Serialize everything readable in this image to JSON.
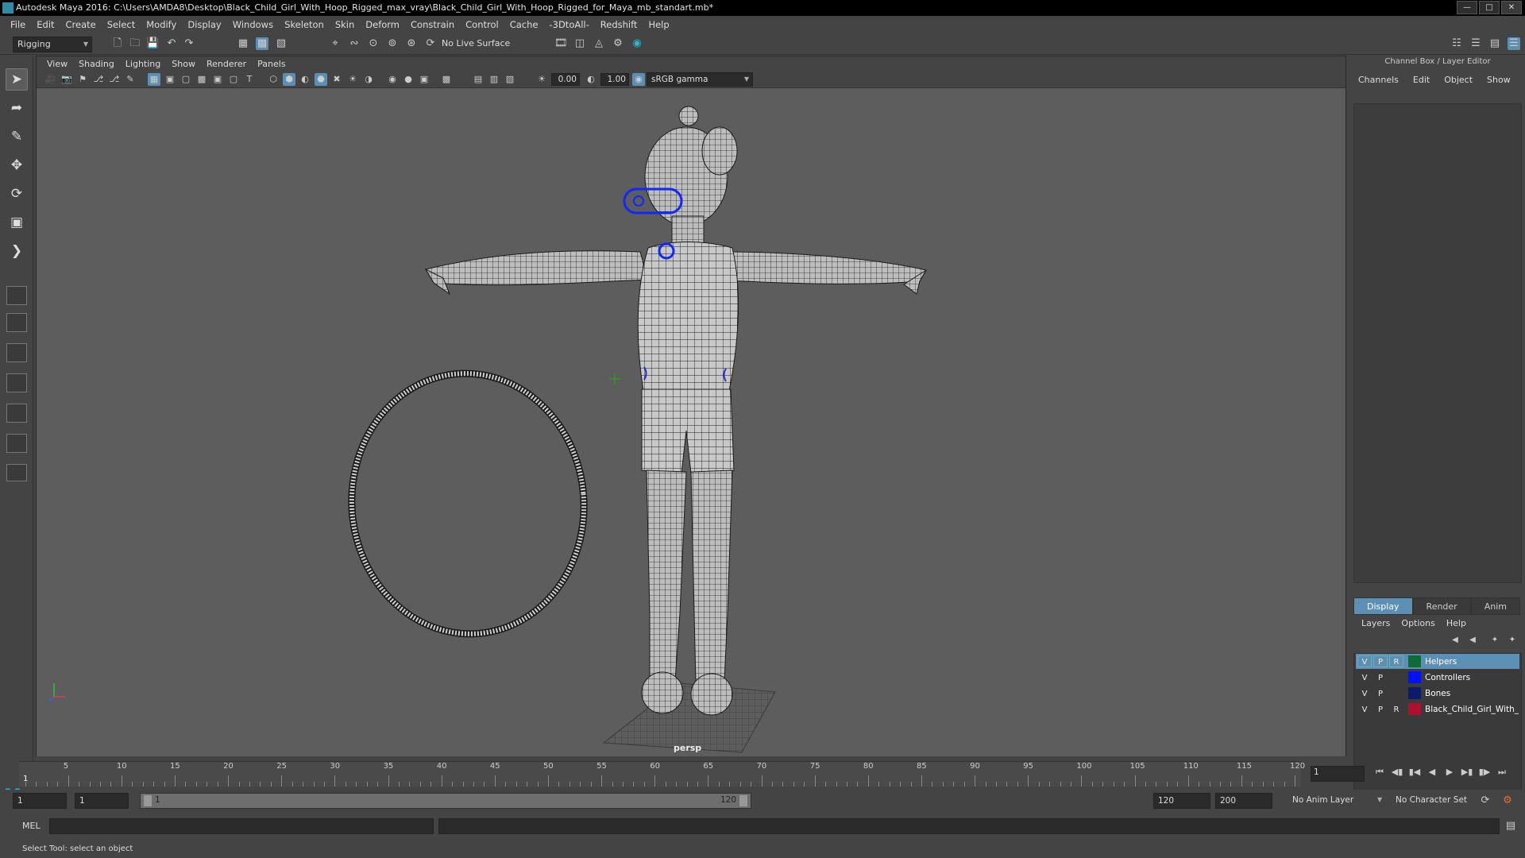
{
  "window": {
    "title": "Autodesk Maya 2016: C:\\Users\\AMDA8\\Desktop\\Black_Child_Girl_With_Hoop_Rigged_max_vray\\Black_Child_Girl_With_Hoop_Rigged_for_Maya_mb_standart.mb*"
  },
  "menubar": [
    "File",
    "Edit",
    "Create",
    "Select",
    "Modify",
    "Display",
    "Windows",
    "Skeleton",
    "Skin",
    "Deform",
    "Constrain",
    "Control",
    "Cache",
    "-3DtoAll-",
    "Redshift",
    "Help"
  ],
  "statusline": {
    "menuset": "Rigging",
    "live_surface": "No Live Surface"
  },
  "panel": {
    "menus": [
      "View",
      "Shading",
      "Lighting",
      "Show",
      "Renderer",
      "Panels"
    ],
    "exposure": "0.00",
    "gamma": "1.00",
    "colorspace": "sRGB gamma",
    "camera_label": "persp"
  },
  "channel_box": {
    "title": "Channel Box / Layer Editor",
    "menus": [
      "Channels",
      "Edit",
      "Object",
      "Show"
    ]
  },
  "layer_editor": {
    "tabs": [
      "Display",
      "Render",
      "Anim"
    ],
    "active_tab": "Display",
    "menus": [
      "Layers",
      "Options",
      "Help"
    ],
    "layers": [
      {
        "v": "V",
        "p": "P",
        "r": "R",
        "color": "#0f6b35",
        "name": "Helpers",
        "selected": true
      },
      {
        "v": "V",
        "p": "P",
        "r": "",
        "color": "#0011ff",
        "name": "Controllers",
        "selected": false
      },
      {
        "v": "V",
        "p": "P",
        "r": "",
        "color": "#0b1a6a",
        "name": "Bones",
        "selected": false
      },
      {
        "v": "V",
        "p": "P",
        "r": "R",
        "color": "#b01030",
        "name": "Black_Child_Girl_With_",
        "selected": false
      }
    ]
  },
  "timeline": {
    "start": 1,
    "end": 120,
    "labels": [
      "5",
      "10",
      "15",
      "20",
      "25",
      "30",
      "35",
      "40",
      "45",
      "50",
      "55",
      "60",
      "65",
      "70",
      "75",
      "80",
      "85",
      "90",
      "95",
      "100",
      "105",
      "110",
      "115",
      "120"
    ],
    "current_frame": "1",
    "current_frame_marker": "1"
  },
  "range": {
    "start_field": "1",
    "playback_start": "1",
    "slider_start": "1",
    "slider_end": "120",
    "playback_end": "120",
    "end_field": "200",
    "anim_layer": "No Anim Layer",
    "character_set": "No Character Set"
  },
  "command": {
    "label": "MEL"
  },
  "help_line": "Select Tool: select an object"
}
